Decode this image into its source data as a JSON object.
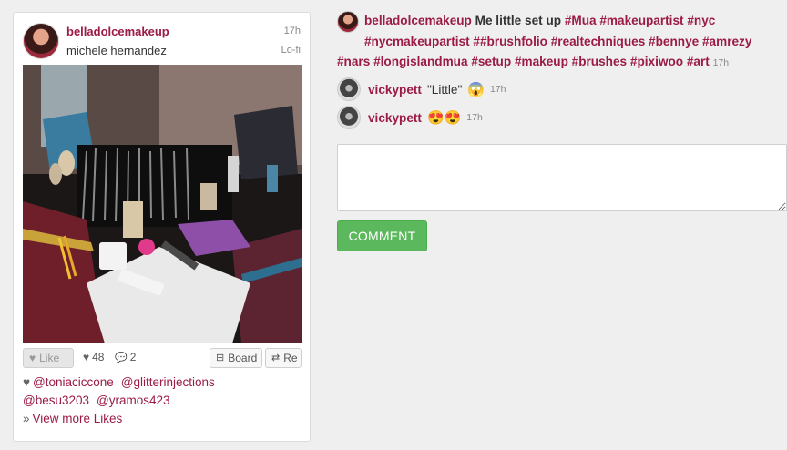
{
  "post": {
    "username": "belladolcemakeup",
    "full_name": "michele hernandez",
    "time": "17h",
    "filter": "Lo-fi"
  },
  "actions": {
    "like_label": "Like",
    "likes_count": "48",
    "comments_count": "2",
    "board_label": "Board",
    "repost_label": "Re"
  },
  "likers": {
    "names": [
      "@toniaciccone",
      "@glitterinjections",
      "@besu3203",
      "@yramos423"
    ],
    "view_more": "View more Likes"
  },
  "caption": {
    "username": "belladolcemakeup",
    "text": "Me little set up",
    "hashtags": [
      "#Mua",
      "#makeupartist",
      "#nyc",
      "#nycmakeupartist",
      "##brushfolio",
      "#realtechniques",
      "#bennye",
      "#amrezy",
      "#nars",
      "#longislandmua",
      "#setup",
      "#makeup",
      "#brushes",
      "#pixiwoo",
      "#art"
    ],
    "time": "17h"
  },
  "comments": [
    {
      "username": "vickypett",
      "text": "\"Little\"",
      "emoji": "😱",
      "time": "17h"
    },
    {
      "username": "vickypett",
      "text": "",
      "emoji": "😍😍",
      "time": "17h"
    }
  ],
  "comment_button": "COMMENT",
  "colors": {
    "accent": "#9b1b44",
    "button_green": "#5cb85c"
  }
}
